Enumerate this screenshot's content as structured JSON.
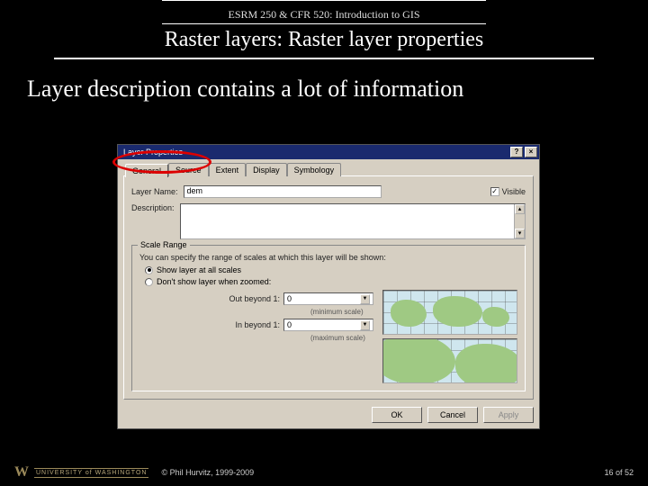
{
  "course_header": "ESRM 250 & CFR 520: Introduction to GIS",
  "slide_title": "Raster layers: Raster layer properties",
  "subtitle": "Layer description contains a lot of information",
  "dialog": {
    "title": "Layer Properties",
    "help_btn": "?",
    "close_btn": "×",
    "tabs": {
      "general": "General",
      "source": "Source",
      "extent": "Extent",
      "display": "Display",
      "symbology": "Symbology"
    },
    "layer_name_label": "Layer Name:",
    "layer_name_value": "dem",
    "visible_label": "Visible",
    "description_label": "Description:",
    "scale_range": {
      "legend": "Scale Range",
      "hint": "You can specify the range of scales at which this layer will be shown:",
      "show_all": "Show layer at all scales",
      "dont_show": "Don't show layer when zoomed:",
      "out_beyond_label": "Out beyond 1:",
      "out_beyond_value": "0",
      "min_scale": "(minimum scale)",
      "in_beyond_label": "In beyond 1:",
      "in_beyond_value": "0",
      "max_scale": "(maximum scale)"
    },
    "buttons": {
      "ok": "OK",
      "cancel": "Cancel",
      "apply": "Apply"
    }
  },
  "footer": {
    "uw_text": "UNIVERSITY of WASHINGTON",
    "copyright": "© Phil Hurvitz, 1999-2009",
    "page": "16 of 52"
  }
}
